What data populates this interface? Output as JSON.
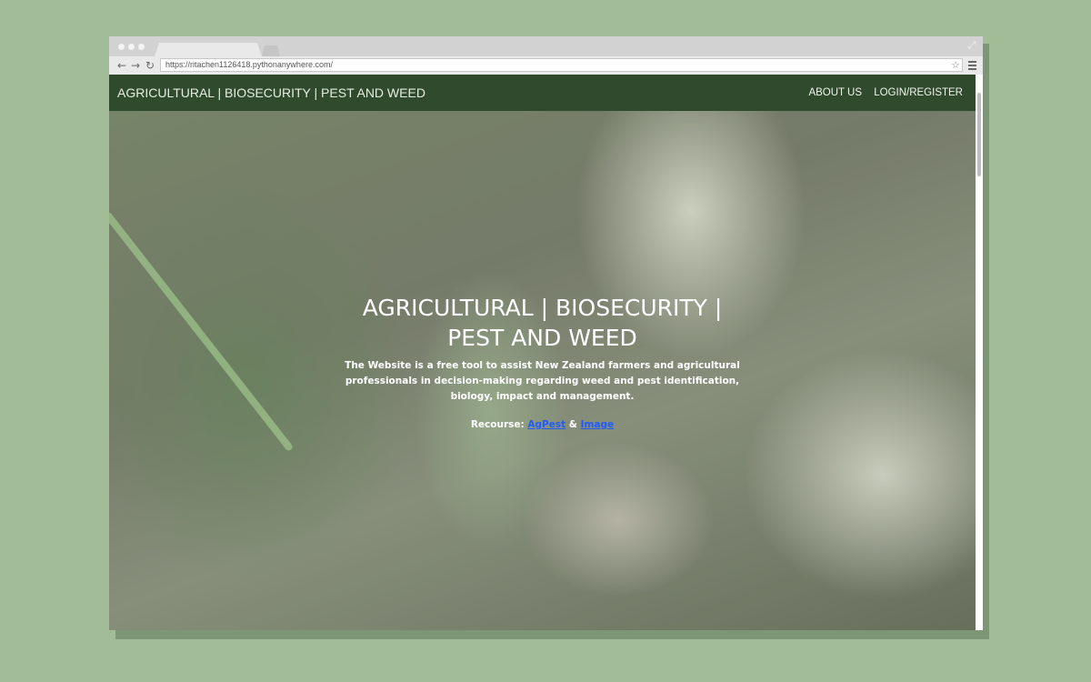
{
  "browser": {
    "url": "https://ritachen1126418.pythonanywhere.com/",
    "icons": {
      "back": "back-arrow-icon",
      "forward": "forward-arrow-icon",
      "reload": "reload-icon",
      "bookmark": "star-icon",
      "menu": "hamburger-menu-icon",
      "maximize": "maximize-icon"
    }
  },
  "navbar": {
    "brand": "AGRICULTURAL | BIOSECURITY | PEST AND WEED",
    "links": [
      "ABOUT US",
      "LOGIN/REGISTER"
    ],
    "background": "#304a2e"
  },
  "hero": {
    "title": "AGRICULTURAL | BIOSECURITY | PEST AND WEED",
    "description": "The Website is a free tool to assist New Zealand farmers and agricultural professionals in decision-making regarding weed and pest identification, biology, impact and management.",
    "resources_label": "Recourse:",
    "resource_links": [
      "AgPest",
      "Image"
    ],
    "resource_separator": "&",
    "link_color": "#1f5bff"
  }
}
